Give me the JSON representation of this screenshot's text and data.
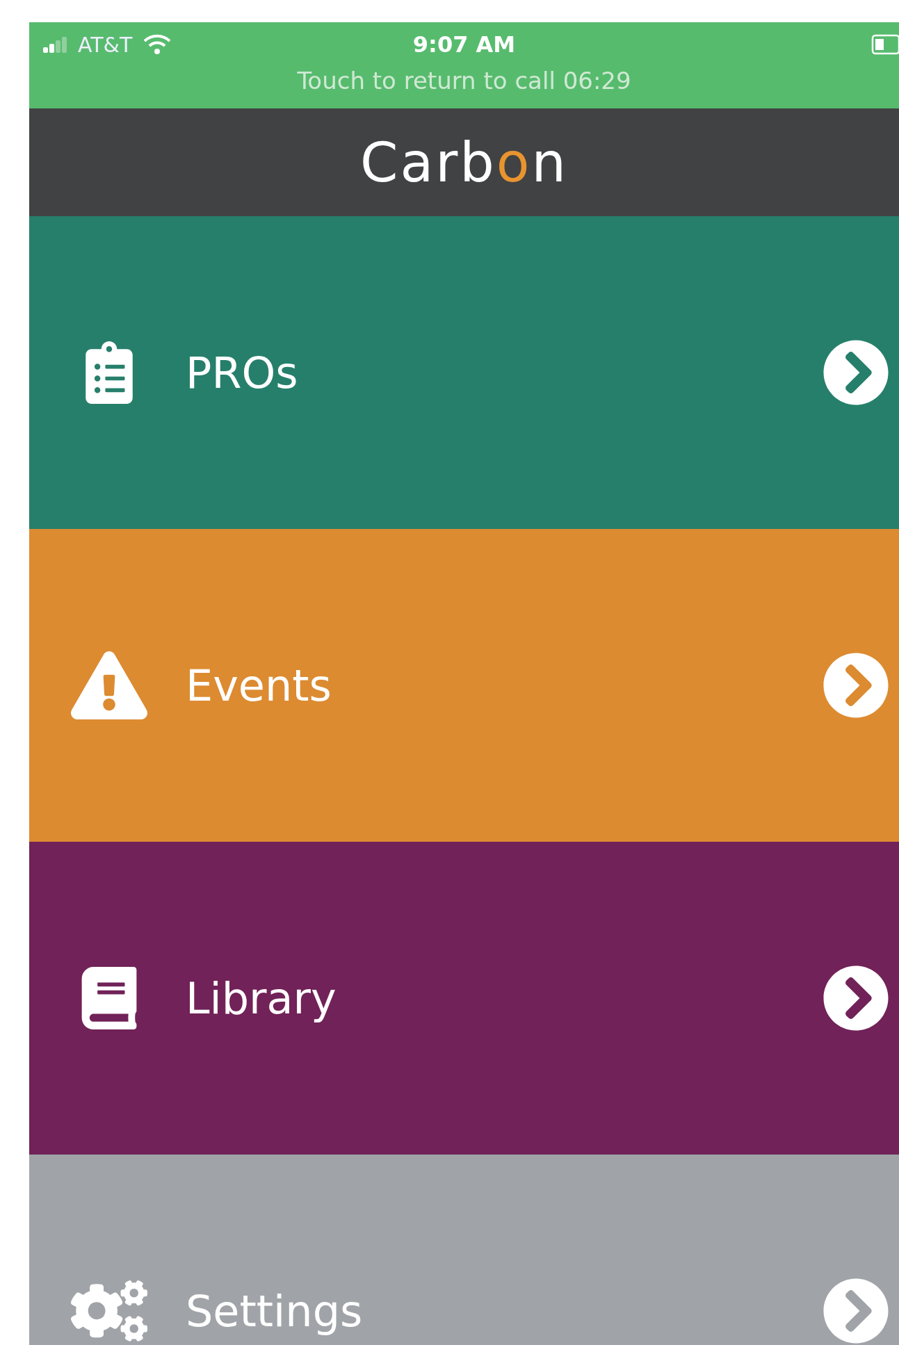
{
  "status_bar": {
    "carrier": "AT&T",
    "time": "9:07 AM",
    "call_banner": "Touch to return to call 06:29"
  },
  "header": {
    "logo": [
      {
        "text": "Carb",
        "accent": false
      },
      {
        "text": "o",
        "accent": true
      },
      {
        "text": "n",
        "accent": false
      }
    ]
  },
  "menu": [
    {
      "label": "PROs",
      "kind": "clipboard",
      "color": "#267f6b"
    },
    {
      "label": "Events",
      "kind": "warning",
      "color": "#dc8b31"
    },
    {
      "label": "Library",
      "kind": "book",
      "color": "#712258"
    },
    {
      "label": "Settings",
      "kind": "gears",
      "color": "#a0a4a8"
    }
  ]
}
